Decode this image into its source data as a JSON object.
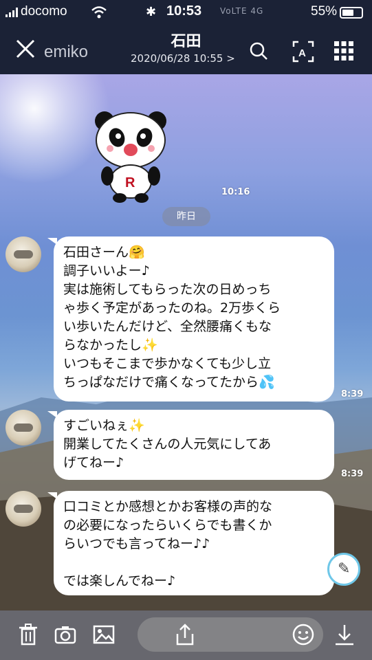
{
  "status_bar": {
    "carrier": "docomo",
    "time": "10:53",
    "misc": "VoLTE 4G",
    "battery_pct": "55%"
  },
  "header": {
    "back_label": "emiko",
    "title": "石田",
    "subtitle": "2020/06/28 10:55 >"
  },
  "chat": {
    "sticker_time": "10:16",
    "date_divider": "昨日",
    "messages": [
      {
        "lines": [
          "石田さーん🤗",
          "調子いいよー♪",
          "実は施術してもらった次の日めっち",
          "ゃ歩く予定があったのね。2万歩くら",
          "い歩いたんだけど、全然腰痛くもな",
          "らなかったし✨",
          "いつもそこまで歩かなくても少し立",
          "ちっぱなだけで痛くなってたから💦"
        ],
        "time": "8:39"
      },
      {
        "lines": [
          "すごいねぇ✨",
          "開業してたくさんの人元気にしてあ",
          "げてねー♪"
        ],
        "time": "8:39"
      },
      {
        "lines": [
          "口コミとか感想とかお客様の声的な",
          "の必要になったらいくらでも書くか",
          "らいつでも言ってねー♪♪",
          "",
          "では楽しんでねー♪"
        ],
        "time": ""
      }
    ]
  },
  "icons": {
    "close": "close-icon",
    "search": "search-icon",
    "translate": "translate-icon",
    "menu": "menu-grid-icon",
    "trash": "trash-icon",
    "camera": "camera-icon",
    "image": "image-icon",
    "share": "share-icon",
    "emoji": "emoji-icon",
    "download": "download-icon",
    "edit": "edit-icon"
  },
  "colors": {
    "header_bg": "#1b2236",
    "bubble_bg": "#ffffff",
    "bottom_bar": "#6e6e73"
  }
}
